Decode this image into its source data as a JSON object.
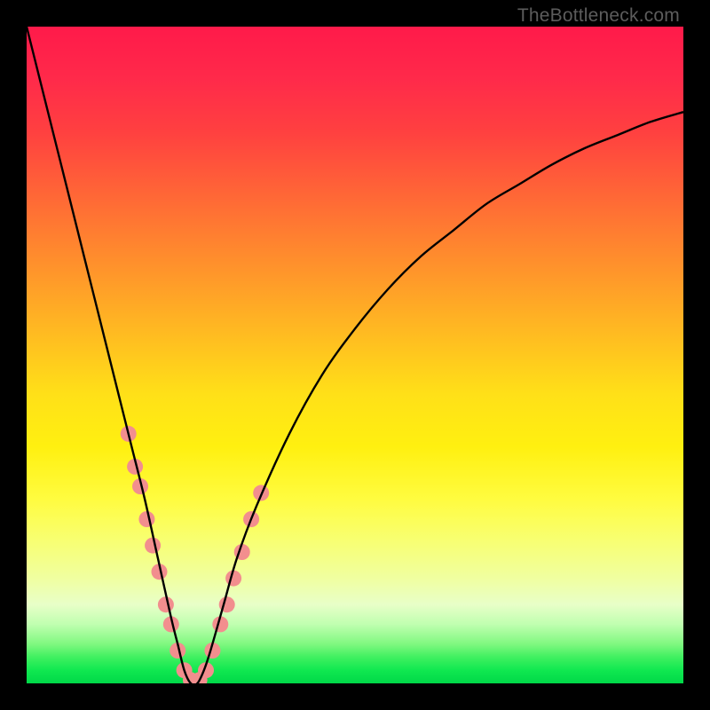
{
  "watermark": "TheBottleneck.com",
  "chart_data": {
    "type": "line",
    "title": "",
    "xlabel": "",
    "ylabel": "",
    "xlim": [
      0,
      100
    ],
    "ylim": [
      0,
      100
    ],
    "minimum_x": 25,
    "series": [
      {
        "name": "bottleneck-curve",
        "x": [
          0,
          2,
          4,
          6,
          8,
          10,
          12,
          14,
          16,
          18,
          20,
          22,
          23,
          24,
          25,
          26,
          27,
          28,
          30,
          32,
          35,
          40,
          45,
          50,
          55,
          60,
          65,
          70,
          75,
          80,
          85,
          90,
          95,
          100
        ],
        "y": [
          100,
          92,
          84,
          76,
          68,
          60,
          52,
          44,
          36,
          28,
          19,
          10,
          6,
          2,
          0,
          0,
          2,
          5,
          12,
          19,
          27,
          38,
          47,
          54,
          60,
          65,
          69,
          73,
          76,
          79,
          81.5,
          83.5,
          85.5,
          87
        ]
      }
    ],
    "markers": {
      "name": "sample-points",
      "color": "#f28e8e",
      "radius": 9,
      "points": [
        {
          "x": 15.5,
          "y": 38
        },
        {
          "x": 16.5,
          "y": 33
        },
        {
          "x": 17.3,
          "y": 30
        },
        {
          "x": 18.3,
          "y": 25
        },
        {
          "x": 19.2,
          "y": 21
        },
        {
          "x": 20.2,
          "y": 17
        },
        {
          "x": 21.2,
          "y": 12
        },
        {
          "x": 22.0,
          "y": 9
        },
        {
          "x": 23.0,
          "y": 5
        },
        {
          "x": 24.0,
          "y": 2
        },
        {
          "x": 25.0,
          "y": 0.5
        },
        {
          "x": 26.3,
          "y": 0.5
        },
        {
          "x": 27.3,
          "y": 2
        },
        {
          "x": 28.3,
          "y": 5
        },
        {
          "x": 29.5,
          "y": 9
        },
        {
          "x": 30.5,
          "y": 12
        },
        {
          "x": 31.5,
          "y": 16
        },
        {
          "x": 32.8,
          "y": 20
        },
        {
          "x": 34.2,
          "y": 25
        },
        {
          "x": 35.7,
          "y": 29
        }
      ]
    },
    "background_gradient": [
      {
        "stop": 0.0,
        "color": "#ff1a4a"
      },
      {
        "stop": 0.5,
        "color": "#ffd018"
      },
      {
        "stop": 0.75,
        "color": "#fcff60"
      },
      {
        "stop": 0.92,
        "color": "#a0ffa0"
      },
      {
        "stop": 1.0,
        "color": "#00d848"
      }
    ]
  }
}
